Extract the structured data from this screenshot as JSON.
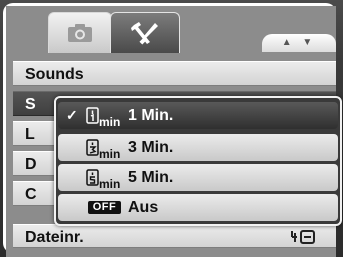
{
  "tabs": [
    {
      "icon": "camera-icon",
      "selected": false
    },
    {
      "icon": "wrench-screwdriver-icon",
      "selected": true
    }
  ],
  "nav_arrows": "▲ ▼",
  "menu": {
    "rows": [
      {
        "label": "Sounds"
      },
      {
        "label": "S"
      },
      {
        "label": "L"
      },
      {
        "label": "D"
      },
      {
        "label": "C"
      },
      {
        "label": "Dateinr.",
        "icon": "file-number-icon"
      }
    ]
  },
  "popup": {
    "options": [
      {
        "label": "1 Min.",
        "icon_sub": "min",
        "selected": true,
        "check": "✓"
      },
      {
        "label": "3 Min.",
        "icon_sub": "min",
        "selected": false
      },
      {
        "label": "5 Min.",
        "icon_sub": "min",
        "selected": false
      },
      {
        "label": "Aus",
        "badge": "OFF",
        "selected": false
      }
    ]
  },
  "colors": {
    "selected_bg": "#3f3f3f",
    "row_bg": "#dcdcdc",
    "accent_white": "#ffffff"
  }
}
